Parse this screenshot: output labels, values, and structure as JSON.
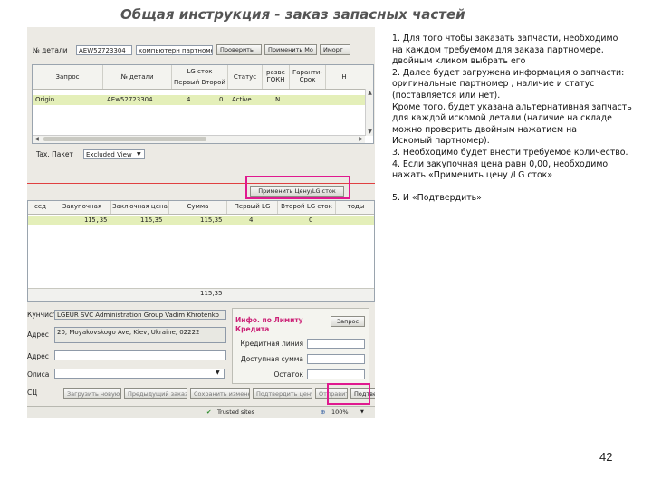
{
  "slide_title": "Общая инструкция - заказ запасных частей",
  "page_number": "42",
  "instructions": [
    "1. Для того чтобы заказать запчасти, необходимо",
    " на каждом требуемом для заказа партномере,",
    "двойным кликом выбрать его",
    "2. Далее будет загружена информация о запчасти:",
    "оригинальные партномер , наличие  и статус",
    "(поставляется или нет).",
    "Кроме того, будет указана альтернативная запчасть",
    "для каждой искомой детали (наличие на складе",
    " можно проверить двойным нажатием на",
    "Искомый партномер).",
    "3. Необходимо будет внести требуемое количество.",
    "4. Если закупочная цена равн 0,00, необходимо",
    "нажать «Применить цену /LG сток»",
    "",
    "5. И «Подтвердить»"
  ],
  "search": {
    "part_label": "№ детали",
    "part_value": "AEW52723304",
    "dropdown_value": "компьютерн партномер",
    "btn_search": "Проверить",
    "btn_apply": "Применить Mo",
    "btn_return": "Иморт"
  },
  "top_grid": {
    "headers": [
      {
        "l1": "Запрос",
        "l2": ""
      },
      {
        "l1": "№ детали",
        "l2": ""
      },
      {
        "l1": "LG сток",
        "l2": "Первый  Второй"
      },
      {
        "l1": "Статус",
        "l2": ""
      },
      {
        "l1": "разве",
        "l2": "ГОКН"
      },
      {
        "l1": "Гаранти-",
        "l2": "Срок"
      },
      {
        "l1": "Н",
        "l2": ""
      }
    ],
    "row": {
      "request": "Origin",
      "part": "AEw52723304",
      "first": "4",
      "second": "0",
      "status": "Active",
      "flag": "N"
    }
  },
  "tax_label": "Tax. Пакет",
  "tax_value": "Excluded View",
  "apply_price_button": "Применить Цену/LG сток",
  "bottom_grid": {
    "headers": [
      "сед",
      "Закупочная цена",
      "Заключная цена",
      "Сумма",
      "Первый LG сток",
      "Второй LG сток",
      "тоды"
    ],
    "row": {
      "purchase_price": "115,35",
      "final_price": "115,35",
      "sum": "115,35",
      "first_stock": "4",
      "second_stock": "0"
    },
    "total": "115,35"
  },
  "customer": {
    "label_name": "Кунчисте",
    "name": "LGEUR SVC Administration Group Vadim Khrotenko",
    "label_address": "Адрес",
    "address": "20, Moyakovskogo Ave, Kiev, Ukraine, 02222",
    "label_phone": "Адрес",
    "label_note": "Описа",
    "label_extra": "СЦ"
  },
  "credit": {
    "title_line1": "Инфо. по Лимиту",
    "title_line2": "Кредита",
    "request_button": "Запрос",
    "credit_limit_label": "Кредитная линия",
    "available_label": "Доступная сумма",
    "remaining_label": "Остаток"
  },
  "bottom_buttons": [
    "Загрузить новую",
    "Предыдущий заказ",
    "Сохранить изменения",
    "Подтвердить цену",
    "Отправить цены",
    "Подтвердить"
  ],
  "statusbar": {
    "trusted": "Trusted sites",
    "zoom": "100%"
  }
}
